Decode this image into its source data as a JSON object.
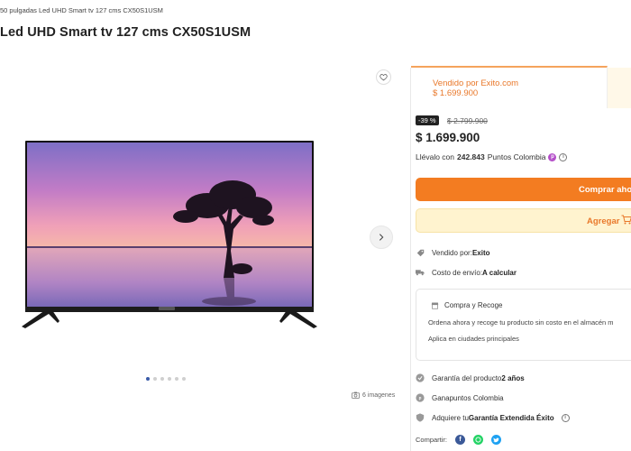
{
  "breadcrumb": "50 pulgadas Led UHD Smart tv 127 cms CX50S1USM",
  "title": "Led UHD Smart tv 127 cms CX50S1USM",
  "gallery": {
    "image_count": "6 imagenes",
    "dot_count": 6,
    "active_dot": 1,
    "icons": {
      "favorite": "heart-outline-icon",
      "next": "chevron-right-icon",
      "images": "camera-icon"
    }
  },
  "seller_card": {
    "label": "Vendido por Exito.com",
    "price": "$ 1.699.900",
    "accent_color": "#e9782a"
  },
  "pricing": {
    "discount": "-39 %",
    "old_price": "$ 2.799.900",
    "price": "$ 1.699.900",
    "points_prefix": "Llévalo con",
    "points_amount": "242.843",
    "points_suffix": "Puntos Colombia"
  },
  "buttons": {
    "buy": "Comprar aho",
    "add": "Agregar",
    "buy_color": "#f37c21",
    "add_bg": "#fff3cf"
  },
  "details": {
    "seller_label": "Vendido por:",
    "seller_value": "Exito",
    "shipping_label": "Costo de envío:",
    "shipping_value": "A calcular"
  },
  "pickup": {
    "title": "Compra y Recoge",
    "desc": "Ordena ahora y recoge tu producto sin costo en el almacén m",
    "note": "Aplica en ciudades principales"
  },
  "extras": {
    "warranty_label": "Garantía del producto",
    "warranty_value": "2 años",
    "points_label": "Gana",
    "points_value": "puntos Colombia",
    "extended_label": "Adquiere tu",
    "extended_value": "Garantía Extendida Éxito"
  },
  "share": {
    "label": "Compartir:",
    "networks": [
      "facebook-icon",
      "whatsapp-icon",
      "twitter-icon"
    ]
  }
}
